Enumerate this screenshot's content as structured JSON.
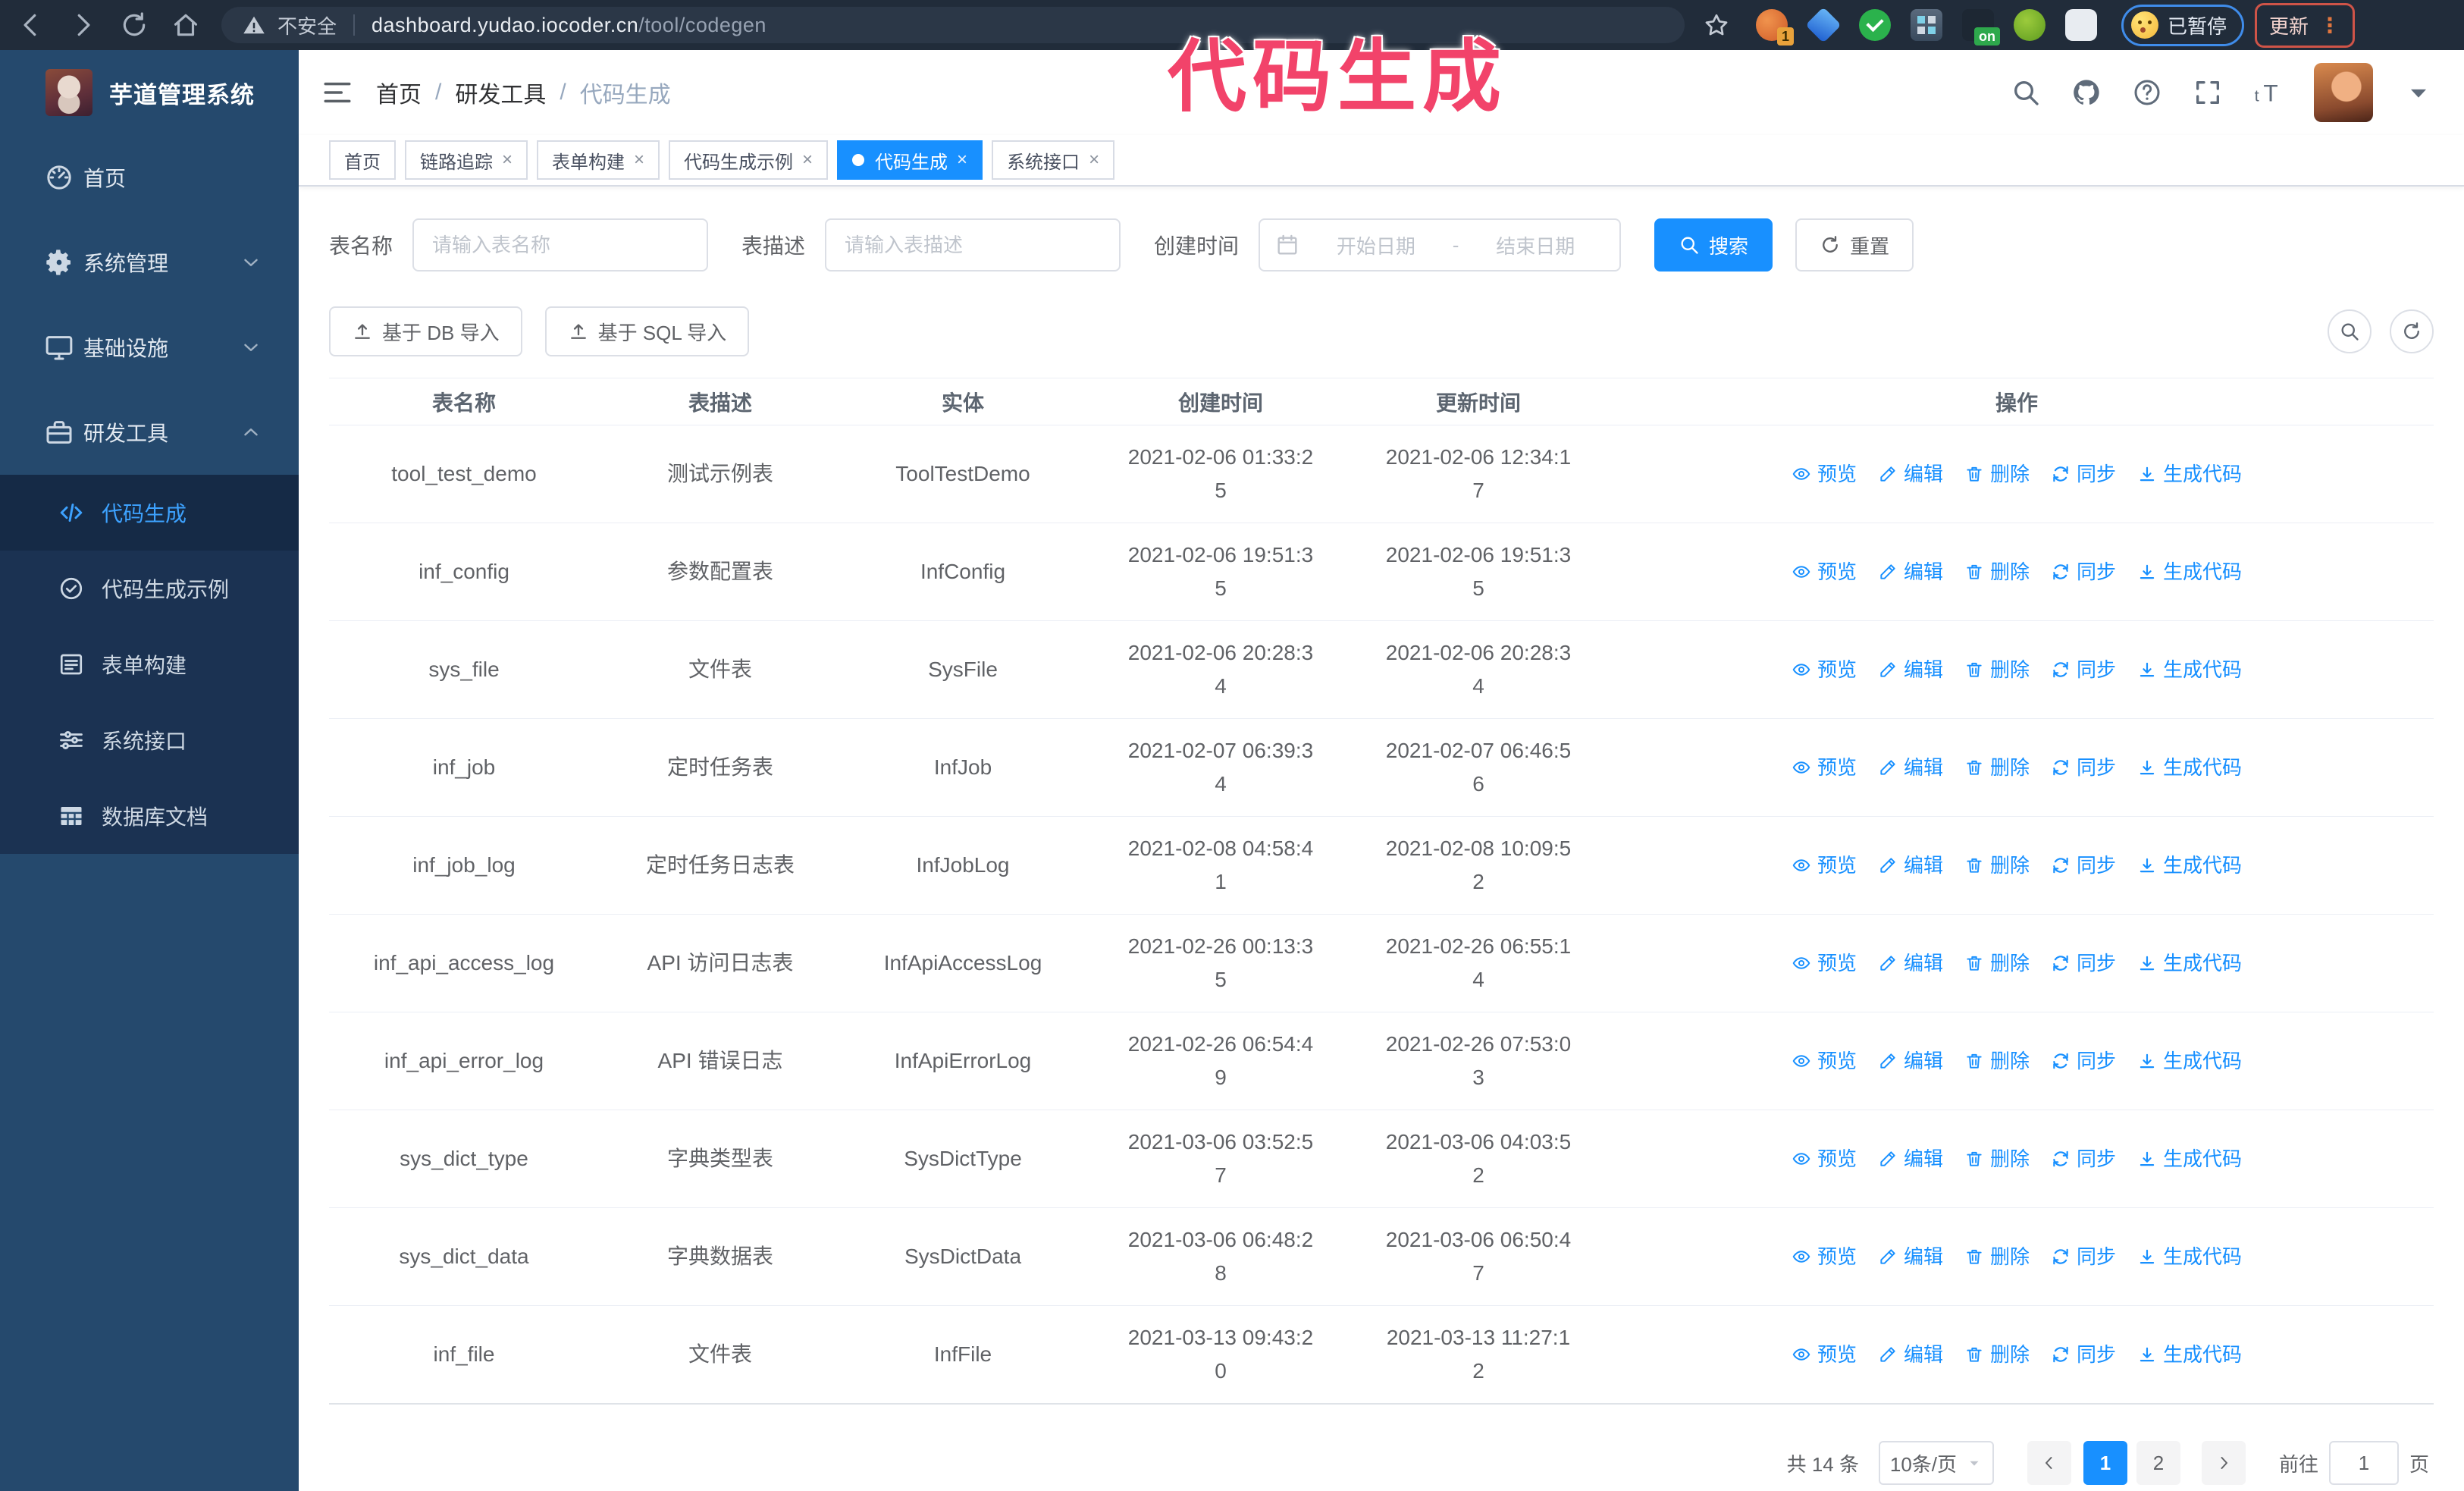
{
  "accent_color": "#1890ff",
  "annotation": {
    "text": "代码生成",
    "color": "#f2436a"
  },
  "browser": {
    "nav_icons": [
      "back-icon",
      "forward-icon",
      "reload-icon",
      "home-icon"
    ],
    "security_label": "不安全",
    "url_host": "dashboard.yudao.iocoder.cn",
    "url_path": "/tool/codegen",
    "bookmark_icon": "star-icon",
    "extensions": [
      {
        "icon": "extension-orange-icon",
        "badge": "1"
      },
      {
        "icon": "gem-icon"
      },
      {
        "icon": "check-badge-icon"
      },
      {
        "icon": "grid-extension-icon"
      },
      {
        "icon": "recorder-icon",
        "badge": "on"
      },
      {
        "icon": "android-icon"
      },
      {
        "icon": "puzzle-icon"
      }
    ],
    "paused_label": "已暂停",
    "update_label": "更新"
  },
  "sidebar": {
    "logo_title": "芋道管理系统",
    "items": [
      {
        "label": "首页",
        "icon": "dashboard-icon"
      },
      {
        "label": "系统管理",
        "icon": "gear-icon",
        "chevron": "chevron-down-icon"
      },
      {
        "label": "基础设施",
        "icon": "monitor-icon",
        "chevron": "chevron-down-icon"
      },
      {
        "label": "研发工具",
        "icon": "toolbox-icon",
        "chevron": "chevron-up-icon"
      }
    ],
    "submenu": [
      {
        "label": "代码生成",
        "icon": "code-icon",
        "active": true
      },
      {
        "label": "代码生成示例",
        "icon": "example-icon"
      },
      {
        "label": "表单构建",
        "icon": "form-icon"
      },
      {
        "label": "系统接口",
        "icon": "api-icon"
      },
      {
        "label": "数据库文档",
        "icon": "dbdoc-icon"
      }
    ]
  },
  "header": {
    "breadcrumb": [
      "首页",
      "研发工具",
      "代码生成"
    ],
    "icons": [
      "search-icon",
      "github-icon",
      "help-icon",
      "fullscreen-icon",
      "font-size-icon"
    ]
  },
  "tabs": [
    {
      "label": "首页",
      "closable": false,
      "active": false
    },
    {
      "label": "链路追踪",
      "closable": true,
      "active": false
    },
    {
      "label": "表单构建",
      "closable": true,
      "active": false
    },
    {
      "label": "代码生成示例",
      "closable": true,
      "active": false
    },
    {
      "label": "代码生成",
      "closable": true,
      "active": true
    },
    {
      "label": "系统接口",
      "closable": true,
      "active": false
    }
  ],
  "filters": {
    "table_name_label": "表名称",
    "table_name_placeholder": "请输入表名称",
    "table_desc_label": "表描述",
    "table_desc_placeholder": "请输入表描述",
    "create_time_label": "创建时间",
    "start_placeholder": "开始日期",
    "range_separator": "-",
    "end_placeholder": "结束日期",
    "search_label": "搜索",
    "reset_label": "重置"
  },
  "toolbar": {
    "import_db_label": "基于 DB 导入",
    "import_sql_label": "基于 SQL 导入",
    "tool_icons": [
      "search-tool-icon",
      "refresh-tool-icon"
    ]
  },
  "table": {
    "columns": [
      "表名称",
      "表描述",
      "实体",
      "创建时间",
      "更新时间",
      "操作"
    ],
    "actions": [
      {
        "label": "预览",
        "icon": "eye-icon"
      },
      {
        "label": "编辑",
        "icon": "edit-icon"
      },
      {
        "label": "删除",
        "icon": "delete-icon"
      },
      {
        "label": "同步",
        "icon": "sync-icon"
      },
      {
        "label": "生成代码",
        "icon": "download-icon"
      }
    ],
    "rows": [
      {
        "name": "tool_test_demo",
        "desc": "测试示例表",
        "entity": "ToolTestDemo",
        "created": "2021-02-06 01:33:25",
        "updated": "2021-02-06 12:34:17"
      },
      {
        "name": "inf_config",
        "desc": "参数配置表",
        "entity": "InfConfig",
        "created": "2021-02-06 19:51:35",
        "updated": "2021-02-06 19:51:35"
      },
      {
        "name": "sys_file",
        "desc": "文件表",
        "entity": "SysFile",
        "created": "2021-02-06 20:28:34",
        "updated": "2021-02-06 20:28:34"
      },
      {
        "name": "inf_job",
        "desc": "定时任务表",
        "entity": "InfJob",
        "created": "2021-02-07 06:39:34",
        "updated": "2021-02-07 06:46:56"
      },
      {
        "name": "inf_job_log",
        "desc": "定时任务日志表",
        "entity": "InfJobLog",
        "created": "2021-02-08 04:58:41",
        "updated": "2021-02-08 10:09:52"
      },
      {
        "name": "inf_api_access_log",
        "desc": "API 访问日志表",
        "entity": "InfApiAccessLog",
        "created": "2021-02-26 00:13:35",
        "updated": "2021-02-26 06:55:14"
      },
      {
        "name": "inf_api_error_log",
        "desc": "API 错误日志",
        "entity": "InfApiErrorLog",
        "created": "2021-02-26 06:54:49",
        "updated": "2021-02-26 07:53:03"
      },
      {
        "name": "sys_dict_type",
        "desc": "字典类型表",
        "entity": "SysDictType",
        "created": "2021-03-06 03:52:57",
        "updated": "2021-03-06 04:03:52"
      },
      {
        "name": "sys_dict_data",
        "desc": "字典数据表",
        "entity": "SysDictData",
        "created": "2021-03-06 06:48:28",
        "updated": "2021-03-06 06:50:47"
      },
      {
        "name": "inf_file",
        "desc": "文件表",
        "entity": "InfFile",
        "created": "2021-03-13 09:43:20",
        "updated": "2021-03-13 11:27:12"
      }
    ]
  },
  "pagination": {
    "total_label": "共 14 条",
    "page_size_label": "10条/页",
    "pages": [
      "1",
      "2"
    ],
    "active_page": "1",
    "goto_label": "前往",
    "goto_value": "1",
    "page_suffix_label": "页"
  }
}
